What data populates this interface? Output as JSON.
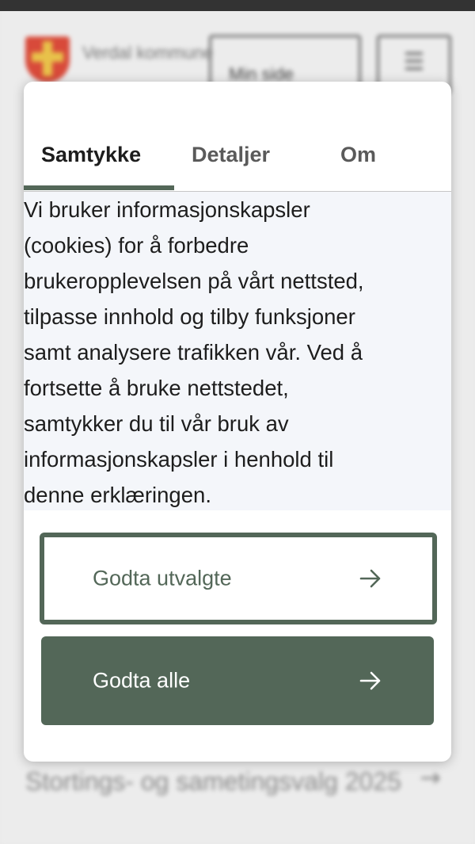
{
  "background": {
    "brand_text": "Verdal kommune",
    "my_page_label": "Min side",
    "menu_icon": "hamburger-icon",
    "article_title": "Stortings- og sametingsvalg 2025"
  },
  "modal": {
    "tabs": [
      {
        "label": "Samtykke",
        "active": true
      },
      {
        "label": "Detaljer",
        "active": false
      },
      {
        "label": "Om",
        "active": false
      }
    ],
    "consent_lines": [
      "Vi bruker informasjonskapsler",
      "(cookies) for å forbedre",
      "brukeropplevelsen på vårt nettsted,",
      "tilpasse innhold og tilby funksjoner",
      "samt analysere trafikken vår. Ved å",
      "fortsette å bruke nettstedet,",
      "samtykker du til vår bruk av",
      "informasjonskapsler i henhold til",
      "denne erklæringen."
    ],
    "accept_selected_label": "Godta utvalgte",
    "accept_all_label": "Godta alle",
    "arrow_icon": "arrow-right-icon"
  },
  "colors": {
    "accent": "#536758",
    "text": "#1d1d1d",
    "muted_tab": "#5a5a5a",
    "text_panel_bg": "#f4f6fa"
  }
}
